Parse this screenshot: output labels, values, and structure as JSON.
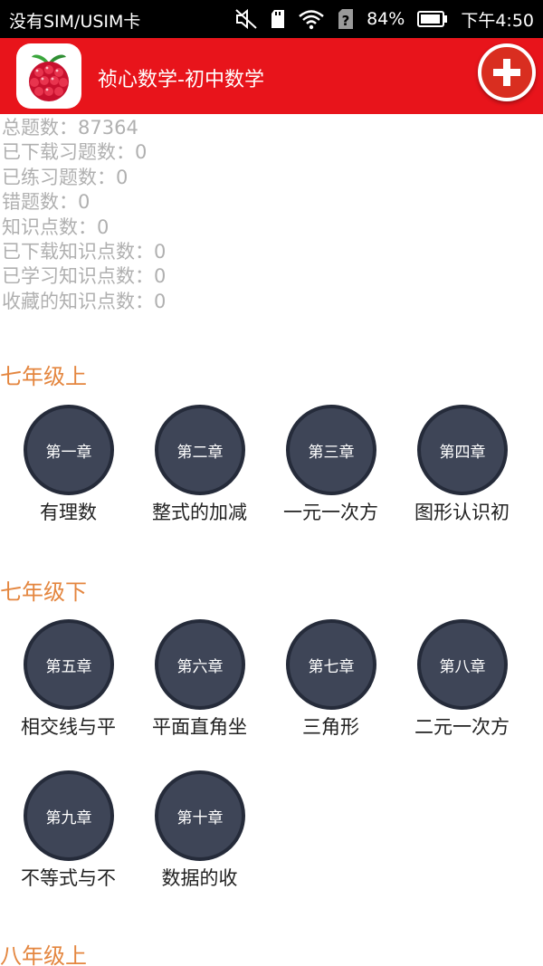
{
  "status_bar": {
    "carrier": "没有SIM/USIM卡",
    "battery": "84%",
    "time": "下午4:50",
    "icons": [
      "mute-icon",
      "sd-card-icon",
      "wifi-icon",
      "no-sim-icon",
      "battery-icon"
    ]
  },
  "app_bar": {
    "title": "祯心数学-初中数学",
    "logo": "raspberry-logo-icon",
    "add_button": "plus-icon",
    "colors": {
      "bar": "#e8141b",
      "button": "#d92e20"
    }
  },
  "stats": [
    "总题数：87364",
    "已下载习题数：0",
    "已练习题数：0",
    "错题数：0",
    "知识点数：0",
    "已下载知识点数：0",
    "已学习知识点数：0",
    "收藏的知识点数：0"
  ],
  "grades": [
    {
      "title": "七年级上",
      "chapters": [
        {
          "label": "第一章",
          "name": "有理数"
        },
        {
          "label": "第二章",
          "name": "整式的加减"
        },
        {
          "label": "第三章",
          "name": "一元一次方"
        },
        {
          "label": "第四章",
          "name": "图形认识初"
        }
      ]
    },
    {
      "title": "七年级下",
      "chapters": [
        {
          "label": "第五章",
          "name": "相交线与平"
        },
        {
          "label": "第六章",
          "name": "平面直角坐"
        },
        {
          "label": "第七章",
          "name": "三角形"
        },
        {
          "label": "第八章",
          "name": "二元一次方"
        },
        {
          "label": "第九章",
          "name": "不等式与不"
        },
        {
          "label": "第十章",
          "name": "数据的收"
        }
      ]
    },
    {
      "title": "八年级上",
      "chapters": []
    }
  ],
  "colors": {
    "grade_title": "#e4863f",
    "chapter_circle": "#3e4557",
    "stats_text": "#b0b0b0"
  }
}
